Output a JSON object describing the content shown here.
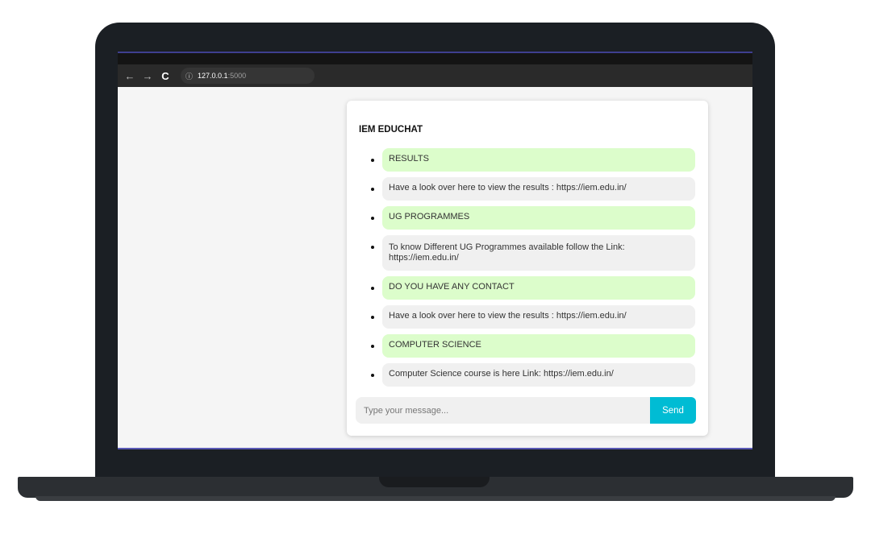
{
  "browser": {
    "address_host": "127.0.0.1",
    "address_port": ":5000",
    "back_icon": "←",
    "forward_icon": "→",
    "reload_icon": "C",
    "info_icon": "ⓘ"
  },
  "chat": {
    "title": "IEM EDUCHAT",
    "messages": [
      {
        "sender": "user",
        "text": "RESULTS"
      },
      {
        "sender": "bot",
        "text": "Have a look over here to view the results : https://iem.edu.in/"
      },
      {
        "sender": "user",
        "text": "UG PROGRAMMES"
      },
      {
        "sender": "bot",
        "text": "To know Different UG Programmes available follow the Link: https://iem.edu.in/"
      },
      {
        "sender": "user",
        "text": "DO YOU HAVE ANY CONTACT"
      },
      {
        "sender": "bot",
        "text": "Have a look over here to view the results : https://iem.edu.in/"
      },
      {
        "sender": "user",
        "text": "COMPUTER SCIENCE"
      },
      {
        "sender": "bot",
        "text": "Computer Science course is here Link: https://iem.edu.in/"
      }
    ],
    "input_placeholder": "Type your message...",
    "input_value": "",
    "send_label": "Send"
  },
  "colors": {
    "user_bubble": "#dcfdcb",
    "bot_bubble": "#f0f0f0",
    "send_button": "#00bcd4"
  }
}
